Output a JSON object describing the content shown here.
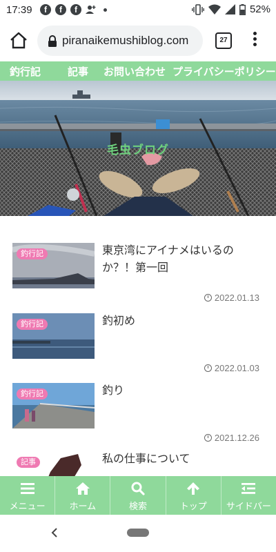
{
  "status_bar": {
    "time": "17:39",
    "battery": "52%",
    "notif_app": "f"
  },
  "browser": {
    "url": "piranaikemushiblog.com",
    "tab_count": "27"
  },
  "site_nav": {
    "items": [
      "釣行記",
      "記事",
      "お問い合わせ",
      "プライバシーポリシー"
    ]
  },
  "hero": {
    "title": "毛虫ブログ"
  },
  "articles": [
    {
      "category": "釣行記",
      "title": "東京湾にアイナメはいるのか？！第一回",
      "date": "2022.01.13"
    },
    {
      "category": "釣行記",
      "title": "釣初め",
      "date": "2022.01.03"
    },
    {
      "category": "釣行記",
      "title": "釣り",
      "date": "2021.12.26"
    },
    {
      "category": "記事",
      "title": "私の仕事について",
      "date": ""
    }
  ],
  "toolbar": {
    "items": [
      {
        "label": "メニュー",
        "icon": "menu-icon"
      },
      {
        "label": "ホーム",
        "icon": "home-icon"
      },
      {
        "label": "検索",
        "icon": "search-icon"
      },
      {
        "label": "トップ",
        "icon": "arrow-up-icon"
      },
      {
        "label": "サイドバー",
        "icon": "sidebar-icon"
      }
    ]
  },
  "colors": {
    "accent_green": "#8fd99b",
    "badge_pink": "#ef7ab2"
  }
}
